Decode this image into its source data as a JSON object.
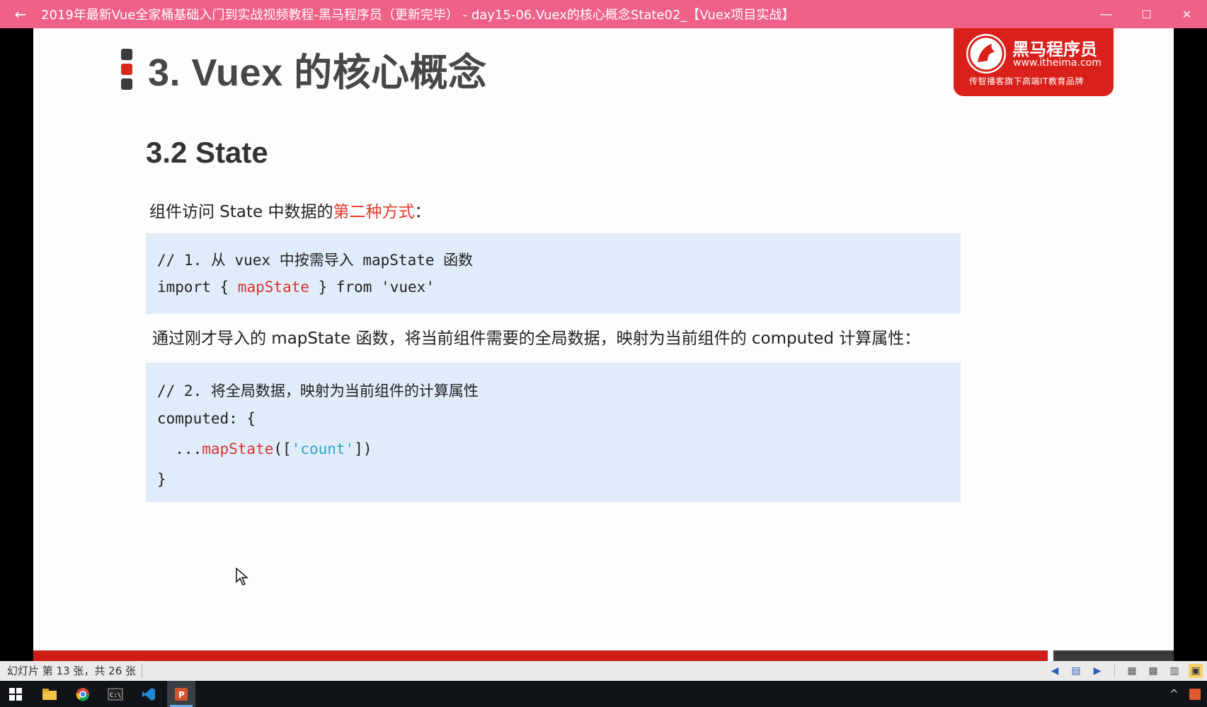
{
  "window": {
    "title": "2019年最新Vue全家桶基础入门到实战视频教程-黑马程序员（更新完毕） - day15-06.Vuex的核心概念State02_【Vuex项目实战】",
    "back_icon": "arrow-left-icon",
    "controls": {
      "minimize": "—",
      "maximize": "☐",
      "close": "✕"
    }
  },
  "slide": {
    "heading": "3. Vuex 的核心概念",
    "logo": {
      "name": "黑马程序员",
      "url": "www.itheima.com",
      "slogan": "传智播客旗下高端IT教育品牌"
    },
    "section_title": "3.2 State",
    "para1": {
      "before": "组件访问 State 中数据的",
      "highlight": "第二种方式",
      "after": "："
    },
    "code1": {
      "line1": "// 1. 从 vuex 中按需导入 mapState 函数",
      "line2_before": "import { ",
      "line2_fn": "mapState",
      "line2_after": " } from 'vuex'"
    },
    "para2": "通过刚才导入的 mapState 函数，将当前组件需要的全局数据，映射为当前组件的 computed 计算属性：",
    "code2": {
      "line1": "// 2. 将全局数据，映射为当前组件的计算属性",
      "line2": "computed: {",
      "line3_indent": "  ...",
      "line3_fn": "mapState",
      "line3_open": "([",
      "line3_str": "'count'",
      "line3_close": "])",
      "line4": "}"
    },
    "colors": {
      "accent_red": "#d01c17",
      "code_bg": "#e1ecfb",
      "title_bar": "#ef6189"
    }
  },
  "statusbar": {
    "slide_info": "幻灯片 第 13 张，共 26 张"
  },
  "taskbar": {
    "apps": [
      "windows-start-icon",
      "file-explorer-icon",
      "chrome-icon",
      "terminal-icon",
      "vscode-icon",
      "powerpoint-icon"
    ]
  }
}
